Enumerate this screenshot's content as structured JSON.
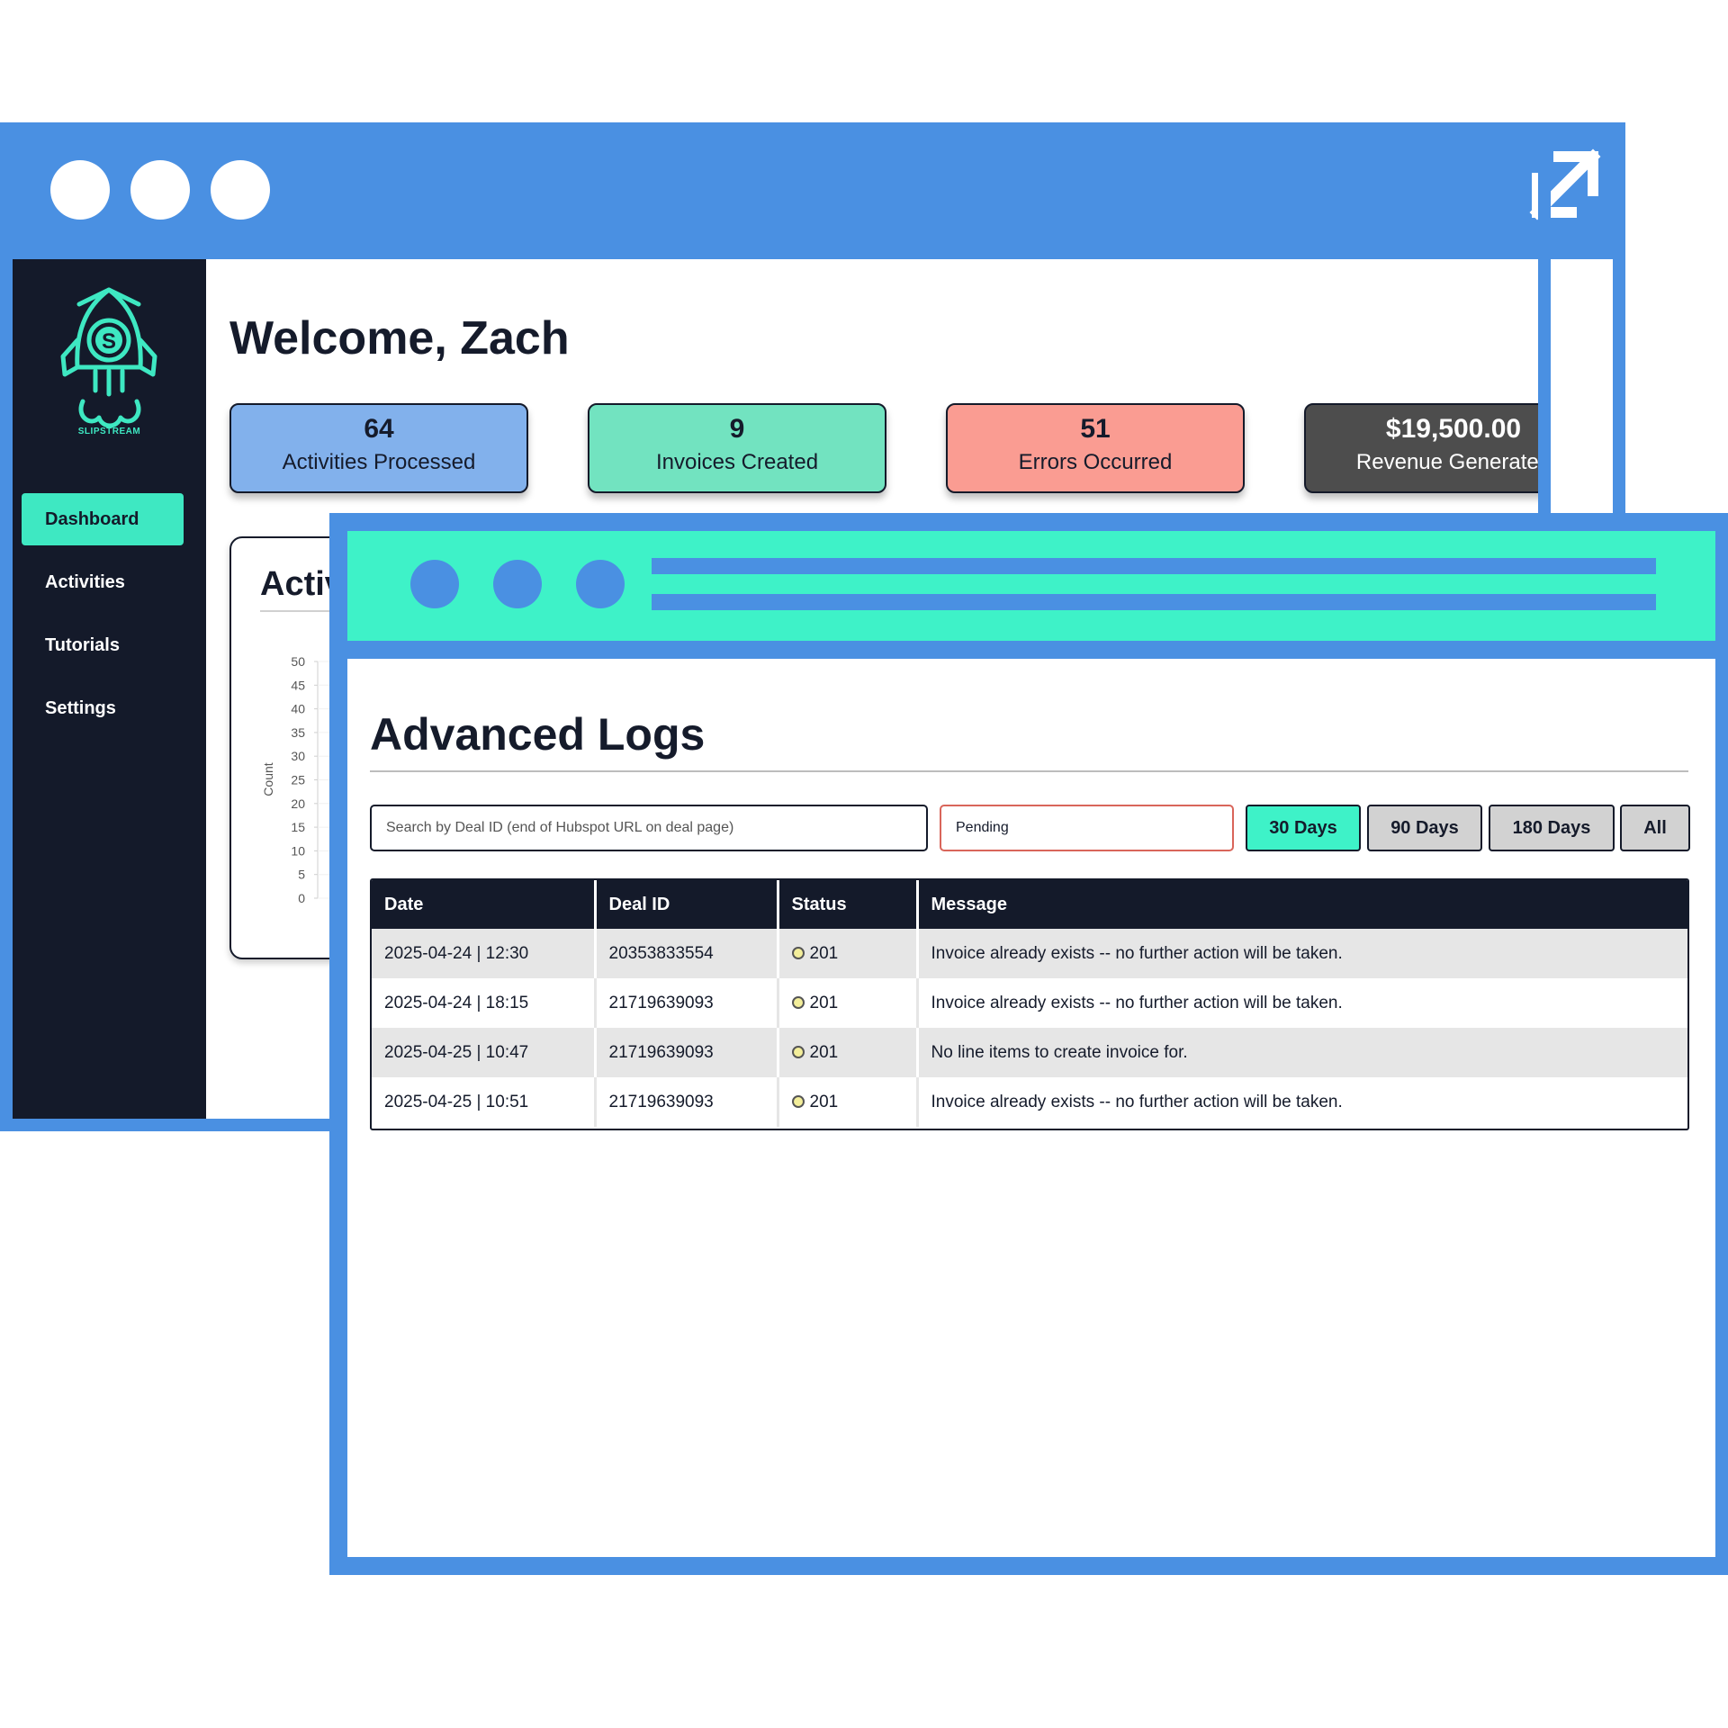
{
  "colors": {
    "frame": "#4a90e2",
    "accent": "#3ef2c8",
    "sidebar": "#141a2a"
  },
  "dashboard": {
    "brand": "SLIPSTREAM",
    "welcome": "Welcome, Zach",
    "nav": [
      {
        "label": "Dashboard",
        "active": true
      },
      {
        "label": "Activities",
        "active": false
      },
      {
        "label": "Tutorials",
        "active": false
      },
      {
        "label": "Settings",
        "active": false
      }
    ],
    "stats": [
      {
        "value": "64",
        "label": "Activities Processed",
        "color": "#82b1ec"
      },
      {
        "value": "9",
        "label": "Invoices Created",
        "color": "#72e3c0"
      },
      {
        "value": "51",
        "label": "Errors Occurred",
        "color": "#fa9c92"
      },
      {
        "value": "$19,500.00",
        "label": "Revenue Generated",
        "color": "#4d4d4d"
      }
    ],
    "chart_title": "Activ",
    "chart_data": {
      "type": "bar",
      "title": "Activ",
      "ylabel": "Count",
      "ylim": [
        0,
        50
      ],
      "yticks": [
        "0",
        "5",
        "10",
        "15",
        "20",
        "25",
        "30",
        "35",
        "40",
        "45",
        "50"
      ],
      "grid": true
    }
  },
  "logs": {
    "title": "Advanced Logs",
    "search_placeholder": "Search by Deal ID (end of Hubspot URL on deal page)",
    "status_filter": "Pending",
    "ranges": [
      {
        "label": "30 Days",
        "active": true
      },
      {
        "label": "90 Days",
        "active": false
      },
      {
        "label": "180 Days",
        "active": false
      },
      {
        "label": "All",
        "active": false
      }
    ],
    "columns": [
      "Date",
      "Deal ID",
      "Status",
      "Message"
    ],
    "rows": [
      {
        "date": "2025-04-24 | 12:30",
        "deal_id": "20353833554",
        "status": "201",
        "message": "Invoice already exists -- no further action will be taken."
      },
      {
        "date": "2025-04-24 | 18:15",
        "deal_id": "21719639093",
        "status": "201",
        "message": "Invoice already exists -- no further action will be taken."
      },
      {
        "date": "2025-04-25 | 10:47",
        "deal_id": "21719639093",
        "status": "201",
        "message": "No line items to create invoice for."
      },
      {
        "date": "2025-04-25 | 10:51",
        "deal_id": "21719639093",
        "status": "201",
        "message": "Invoice already exists -- no further action will be taken."
      }
    ]
  }
}
